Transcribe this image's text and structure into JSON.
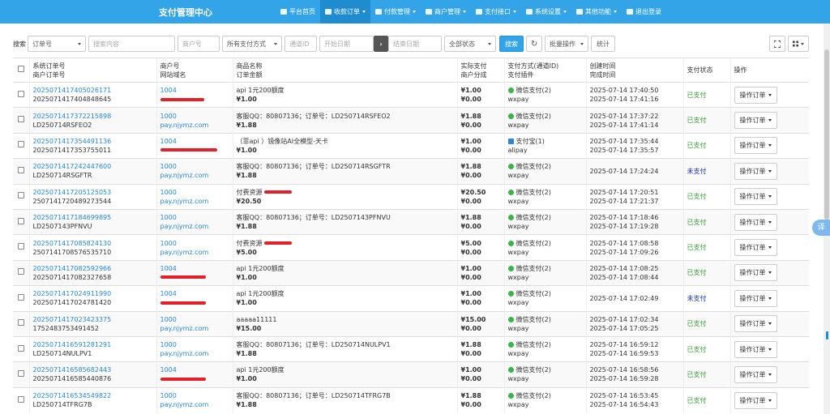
{
  "header": {
    "title": "支付管理中心",
    "nav": [
      {
        "label": "平台首页",
        "icon": "home-icon",
        "dropdown": false,
        "active": false
      },
      {
        "label": "收款订单",
        "icon": "list-icon",
        "dropdown": true,
        "active": true
      },
      {
        "label": "付款管理",
        "icon": "cloud-icon",
        "dropdown": true,
        "active": false
      },
      {
        "label": "商户管理",
        "icon": "user-icon",
        "dropdown": true,
        "active": false
      },
      {
        "label": "支付接口",
        "icon": "card-icon",
        "dropdown": true,
        "active": false
      },
      {
        "label": "系统设置",
        "icon": "gear-icon",
        "dropdown": true,
        "active": false
      },
      {
        "label": "其他功能",
        "icon": "grid-icon",
        "dropdown": true,
        "active": false
      },
      {
        "label": "退出登录",
        "icon": "power-icon",
        "dropdown": false,
        "active": false
      }
    ]
  },
  "toolbar": {
    "search_label": "搜索",
    "field_select": "订单号",
    "search_placeholder": "搜索内容",
    "merchant_placeholder": "商户号",
    "paytype_select": "所有支付方式",
    "channel_placeholder": "通道ID",
    "start_placeholder": "开始日期",
    "range_arrow": "›",
    "end_placeholder": "结束日期",
    "status_select": "全部状态",
    "search_button": "搜索",
    "refresh_icon": "↻",
    "batch_button": "批量操作",
    "stats_button": "统计"
  },
  "table": {
    "headers": [
      [
        "系统订单号",
        "商户订单号"
      ],
      [
        "商户号",
        "网站域名"
      ],
      [
        "商品名称",
        "订单金额"
      ],
      [
        "实际支付",
        "商户分成"
      ],
      [
        "支付方式(通道ID)",
        "支付插件"
      ],
      [
        "创建时间",
        "完成时间"
      ],
      [
        "支付状态"
      ],
      [
        "操作"
      ]
    ],
    "rows": [
      {
        "sys": "2025071417405026171",
        "mch_no": "2025071417404848645",
        "mch": "1004",
        "domain": "",
        "redact": 54,
        "name": "api 1元200额度",
        "amount": "¥1.00",
        "paid": "¥1.00",
        "share": "¥0.00",
        "method": "微信支付(2)",
        "plugin": "wxpay",
        "created": "2025-07-14 17:40:50",
        "done": "2025-07-14 17:41:16",
        "status": "已支付",
        "status_type": "paid",
        "op": "操作订单",
        "ali": false,
        "name_redact": 0
      },
      {
        "sys": "2025071417372215898",
        "mch_no": "LD250714RSFEO2",
        "mch": "1000",
        "domain": "pay.njymz.com",
        "redact": 0,
        "name": "客服QQ：80807136；订单号：LD250714RSFEO2",
        "amount": "¥1.88",
        "paid": "¥1.88",
        "share": "¥0.00",
        "method": "微信支付(2)",
        "plugin": "wxpay",
        "created": "2025-07-14 17:37:22",
        "done": "2025-07-14 17:41:14",
        "status": "已支付",
        "status_type": "paid",
        "op": "操作订单",
        "ali": false,
        "name_redact": 0
      },
      {
        "sys": "2025071417354491136",
        "mch_no": "2025071417353755011",
        "mch": "1004",
        "domain": "",
        "redact": 70,
        "name": "（菲api ）镜像站AI全模型-天卡",
        "amount": "¥1.00",
        "paid": "¥1.00",
        "share": "¥0.00",
        "method": "支付宝(1)",
        "plugin": "alipay",
        "created": "2025-07-14 17:35:44",
        "done": "2025-07-14 17:35:57",
        "status": "已支付",
        "status_type": "paid",
        "op": "操作订单",
        "ali": true,
        "name_redact": 0
      },
      {
        "sys": "2025071417242447600",
        "mch_no": "LD250714RSGFTR",
        "mch": "1000",
        "domain": "pay.njymz.com",
        "redact": 0,
        "name": "客服QQ：80807136；订单号：LD250714RSGFTR",
        "amount": "¥1.88",
        "paid": "¥1.88",
        "share": "¥0.00",
        "method": "微信支付(2)",
        "plugin": "wxpay",
        "created": "2025-07-14 17:24:24",
        "done": "",
        "status": "未支付",
        "status_type": "unpaid",
        "op": "操作订单",
        "ali": false,
        "name_redact": 0
      },
      {
        "sys": "2025071417205125053",
        "mch_no": "2507141720489273544",
        "mch": "1000",
        "domain": "pay.njymz.com",
        "redact": 0,
        "name": "付费资源",
        "amount": "¥20.50",
        "paid": "¥20.50",
        "share": "¥0.00",
        "method": "微信支付(2)",
        "plugin": "wxpay",
        "created": "2025-07-14 17:20:51",
        "done": "2025-07-14 17:21:37",
        "status": "已支付",
        "status_type": "paid",
        "op": "操作订单",
        "ali": false,
        "name_redact": 34
      },
      {
        "sys": "2025071417184699895",
        "mch_no": "LD2507143PFNVU",
        "mch": "1000",
        "domain": "pay.njymz.com",
        "redact": 0,
        "name": "客服QQ：80807136；订单号：LD2507143PFNVU",
        "amount": "¥1.88",
        "paid": "¥1.88",
        "share": "¥0.00",
        "method": "微信支付(2)",
        "plugin": "wxpay",
        "created": "2025-07-14 17:18:46",
        "done": "2025-07-14 17:19:28",
        "status": "已支付",
        "status_type": "paid",
        "op": "操作订单",
        "ali": false,
        "name_redact": 0
      },
      {
        "sys": "2025071417085824130",
        "mch_no": "2507141708576535710",
        "mch": "1000",
        "domain": "pay.njymz.com",
        "redact": 0,
        "name": "付费资源",
        "amount": "¥5.00",
        "paid": "¥5.00",
        "share": "¥0.00",
        "method": "微信支付(2)",
        "plugin": "wxpay",
        "created": "2025-07-14 17:08:58",
        "done": "2025-07-14 17:09:26",
        "status": "已支付",
        "status_type": "paid",
        "op": "操作订单",
        "ali": false,
        "name_redact": 34
      },
      {
        "sys": "2025071417082592966",
        "mch_no": "2025071417082327658",
        "mch": "1004",
        "domain": "",
        "redact": 56,
        "name": "api 1元200额度",
        "amount": "¥1.00",
        "paid": "¥1.00",
        "share": "¥0.00",
        "method": "微信支付(2)",
        "plugin": "wxpay",
        "created": "2025-07-14 17:08:25",
        "done": "2025-07-14 17:08:44",
        "status": "已支付",
        "status_type": "paid",
        "op": "操作订单",
        "ali": false,
        "name_redact": 0
      },
      {
        "sys": "2025071417024911990",
        "mch_no": "2025071417024781420",
        "mch": "1004",
        "domain": "",
        "redact": 56,
        "name": "api 1元200额度",
        "amount": "¥1.00",
        "paid": "¥1.00",
        "share": "¥0.00",
        "method": "微信支付(2)",
        "plugin": "wxpay",
        "created": "2025-07-14 17:02:49",
        "done": "",
        "status": "未支付",
        "status_type": "unpaid",
        "op": "操作订单",
        "ali": false,
        "name_redact": 0
      },
      {
        "sys": "2025071417023423375",
        "mch_no": "1752483753491452",
        "mch": "1000",
        "domain": "pay.njymz.com",
        "redact": 0,
        "name": "aaaaa11111",
        "amount": "¥15.00",
        "paid": "¥15.00",
        "share": "¥0.00",
        "method": "微信支付(2)",
        "plugin": "wxpay",
        "created": "2025-07-14 17:02:34",
        "done": "2025-07-14 17:05:25",
        "status": "已支付",
        "status_type": "paid",
        "op": "操作订单",
        "ali": false,
        "name_redact": 0
      },
      {
        "sys": "2025071416591281291",
        "mch_no": "LD250714NULPV1",
        "mch": "1000",
        "domain": "pay.njymz.com",
        "redact": 0,
        "name": "客服QQ：80807136；订单号：LD250714NULPV1",
        "amount": "¥1.88",
        "paid": "¥1.88",
        "share": "¥0.00",
        "method": "微信支付(2)",
        "plugin": "wxpay",
        "created": "2025-07-14 16:59:12",
        "done": "2025-07-14 16:59:53",
        "status": "已支付",
        "status_type": "paid",
        "op": "操作订单",
        "ali": false,
        "name_redact": 0
      },
      {
        "sys": "2025071416585682443",
        "mch_no": "2025071416585440876",
        "mch": "1004",
        "domain": "",
        "redact": 56,
        "name": "api 1元200额度",
        "amount": "¥1.00",
        "paid": "¥1.00",
        "share": "¥0.00",
        "method": "微信支付(2)",
        "plugin": "wxpay",
        "created": "2025-07-14 16:58:56",
        "done": "2025-07-14 16:59:28",
        "status": "已支付",
        "status_type": "paid",
        "op": "操作订单",
        "ali": false,
        "name_redact": 0
      },
      {
        "sys": "2025071416534549822",
        "mch_no": "LD250714TFRG7B",
        "mch": "1000",
        "domain": "pay.njymz.com",
        "redact": 0,
        "name": "客服QQ：80807136；订单号：LD250714TFRG7B",
        "amount": "¥1.88",
        "paid": "¥1.88",
        "share": "¥0.00",
        "method": "微信支付(2)",
        "plugin": "wxpay",
        "created": "2025-07-14 16:53:45",
        "done": "2025-07-14 16:54:43",
        "status": "已支付",
        "status_type": "paid",
        "op": "操作订单",
        "ali": false,
        "name_redact": 0
      }
    ]
  },
  "float_button": "译",
  "colors": {
    "brand": "#33a4e8",
    "paid": "#3a9a3a",
    "unpaid": "#1a2fa8",
    "link": "#2a87d0",
    "redaction": "#e0202a"
  }
}
